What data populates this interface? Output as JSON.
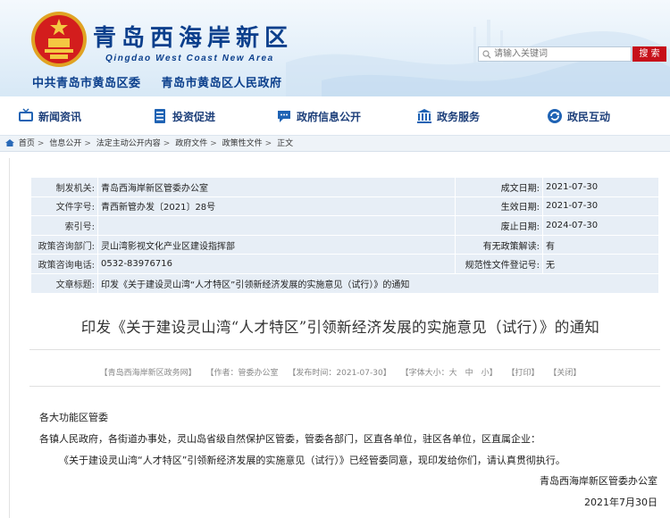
{
  "header": {
    "site_title": "青岛西海岸新区",
    "site_subtitle": "Qingdao West Coast New Area",
    "org_1": "中共青岛市黄岛区委",
    "org_2": "青岛市黄岛区人民政府",
    "search_placeholder": "请输入关键词",
    "search_button": "搜 索"
  },
  "nav": [
    {
      "label": "新闻资讯",
      "icon": "tv-icon"
    },
    {
      "label": "投资促进",
      "icon": "document-list-icon"
    },
    {
      "label": "政府信息公开",
      "icon": "chat-icon"
    },
    {
      "label": "政务服务",
      "icon": "building-icon"
    },
    {
      "label": "政民互动",
      "icon": "refresh-icon"
    }
  ],
  "breadcrumb": [
    "首页",
    "信息公开",
    "法定主动公开内容",
    "政府文件",
    "政策性文件",
    "正文"
  ],
  "meta": {
    "issuer_label": "制发机关:",
    "issuer": "青岛西海岸新区管委办公室",
    "doc_no_label": "文件字号:",
    "doc_no": "青西新管办发〔2021〕28号",
    "index_label": "索引号:",
    "index": "",
    "consult_dept_label": "政策咨询部门:",
    "consult_dept": "灵山湾影视文化产业区建设指挥部",
    "consult_phone_label": "政策咨询电话:",
    "consult_phone": "0532-83976716",
    "subject_label": "文章标题:",
    "subject": "印发《关于建设灵山湾“人才特区”引领新经济发展的实施意见（试行）》的通知",
    "created_label": "成文日期:",
    "created": "2021-07-30",
    "effective_label": "生效日期:",
    "effective": "2021-07-30",
    "repeal_label": "废止日期:",
    "repeal": "2024-07-30",
    "interpret_label": "有无政策解读:",
    "interpret": "有",
    "registration_label": "规范性文件登记号:",
    "registration": "无"
  },
  "doc": {
    "title": "印发《关于建设灵山湾“人才特区”引领新经济发展的实施意见（试行）》的通知",
    "source": "【青岛西海岸新区政务网】",
    "author": "【作者：管委办公室",
    "published": "【发布时间：2021-07-30】",
    "font_size": "【字体大小：大　中　小】",
    "print": "【打印】",
    "close": "【关闭】",
    "salutation": "各大功能区管委",
    "recipients": "各镇人民政府，各街道办事处，灵山岛省级自然保护区管委，管委各部门，区直各单位，驻区各单位，区直属企业：",
    "paragraph": "《关于建设灵山湾“人才特区”引领新经济发展的实施意见（试行）》已经管委同意，现印发给你们，请认真贯彻执行。",
    "signature": "青岛西海岸新区管委办公室",
    "date": "2021年7月30日"
  },
  "colors": {
    "brand_blue": "#0b3f8c",
    "search_red": "#c7101a",
    "table_bg": "#e7eef6"
  }
}
